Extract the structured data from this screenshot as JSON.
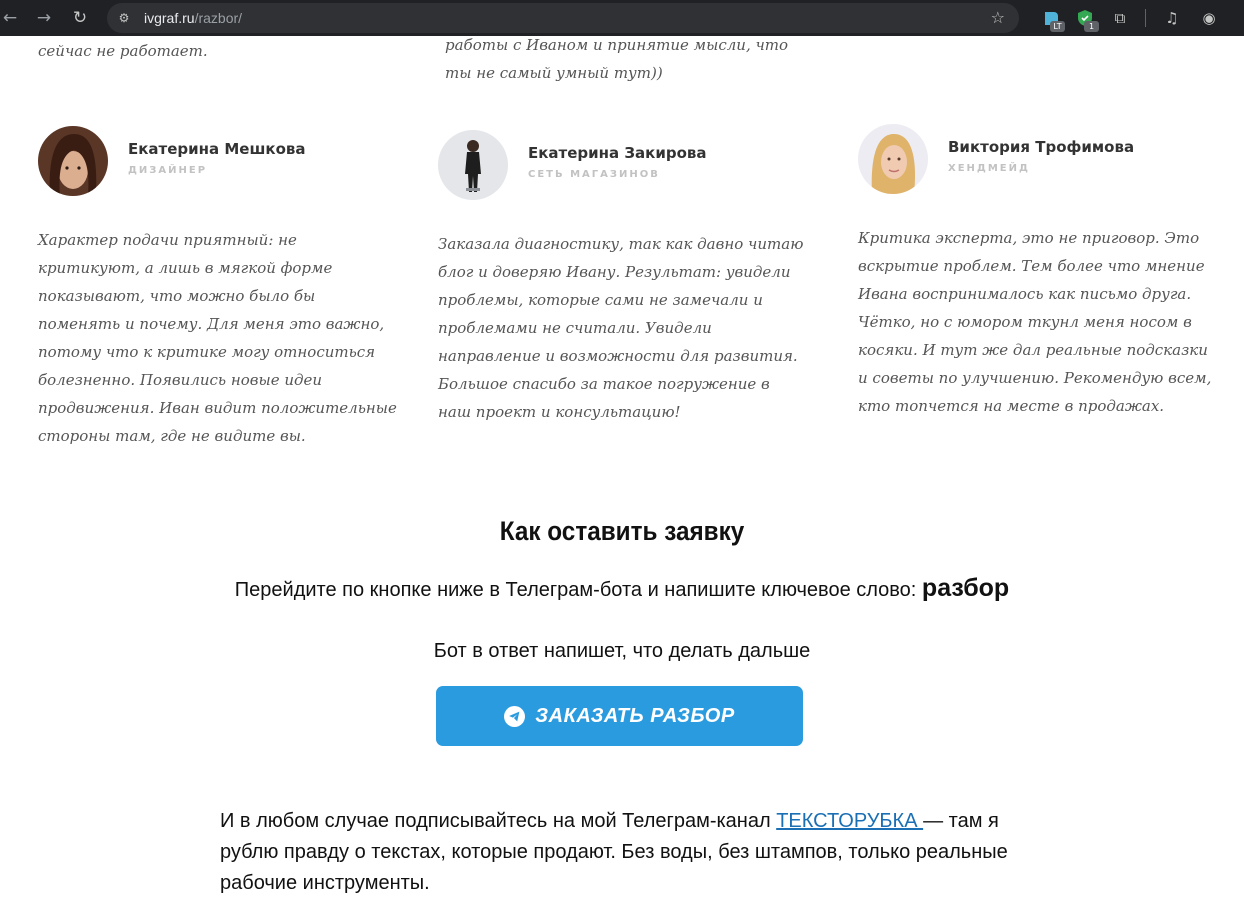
{
  "browser": {
    "back_icon": "←",
    "forward_icon": "→",
    "reload_icon": "↻",
    "site_info_icon": "⚙",
    "url_host": "ivgraf.ru",
    "url_path": "/razbor/",
    "bookmark_icon": "☆",
    "ext1_badge": "LT",
    "ext2_badge": "1",
    "extensions_icon": "⧉",
    "media_icon": "♫",
    "profile_icon": "◉"
  },
  "top_fragments": {
    "left": "сейчас не работает.",
    "middle_line1": "работы с Иваном и принятие мысли, что",
    "middle_line2": "ты не самый умный тут))"
  },
  "reviews": [
    {
      "name": "Екатерина Мешкова",
      "role": "ДИЗАЙНЕР",
      "text": "Характер подачи приятный: не критикуют, а лишь в мягкой форме показывают, что можно было бы поменять и почему. Для меня это важно, потому что к критике могу относиться болезненно. Появились новые идеи продвижения. Иван видит положительные стороны там, где не видите вы."
    },
    {
      "name": "Екатерина Закирова",
      "role": "СЕТЬ МАГАЗИНОВ",
      "text": "Заказала диагностику, так как давно читаю блог и доверяю Ивану. Результат: увидели проблемы, которые сами не замечали и проблемами не считали. Увидели направление и возможности для развития. Большое спасибо за такое погружение в наш проект и консультацию!"
    },
    {
      "name": "Виктория Трофимова",
      "role": "ХЕНДМЕЙД",
      "text": "Критика эксперта, это не приговор. Это вскрытие проблем. Тем более что мнение Ивана воспринималось как письмо друга. Чётко, но с юмором ткунл меня носом в косяки. И тут же дал реальные подсказки и советы по улучшению. Рекомендую всем, кто топчется на месте в продажах."
    }
  ],
  "how_to": {
    "title": "Как оставить заявку",
    "instruction": "Перейдите по кнопке ниже в Телеграм-бота и напишите ключевое слово: ",
    "keyword": "разбор",
    "bot_note": "Бот в ответ напишет, что делать дальше",
    "button_label": "ЗАКАЗАТЬ РАЗБОР"
  },
  "subscribe": {
    "before": "И в любом случае подписывайтесь на мой Телеграм-канал ",
    "link_text": "ТЕКСТОРУБКА ",
    "after": " — там я рублю правду о текстах, которые продают. Без воды, без штампов, только реальные рабочие инструменты."
  },
  "colors": {
    "chrome_bg": "#202124",
    "cta_bg": "#2b9be0",
    "link": "#1a6fb5"
  }
}
